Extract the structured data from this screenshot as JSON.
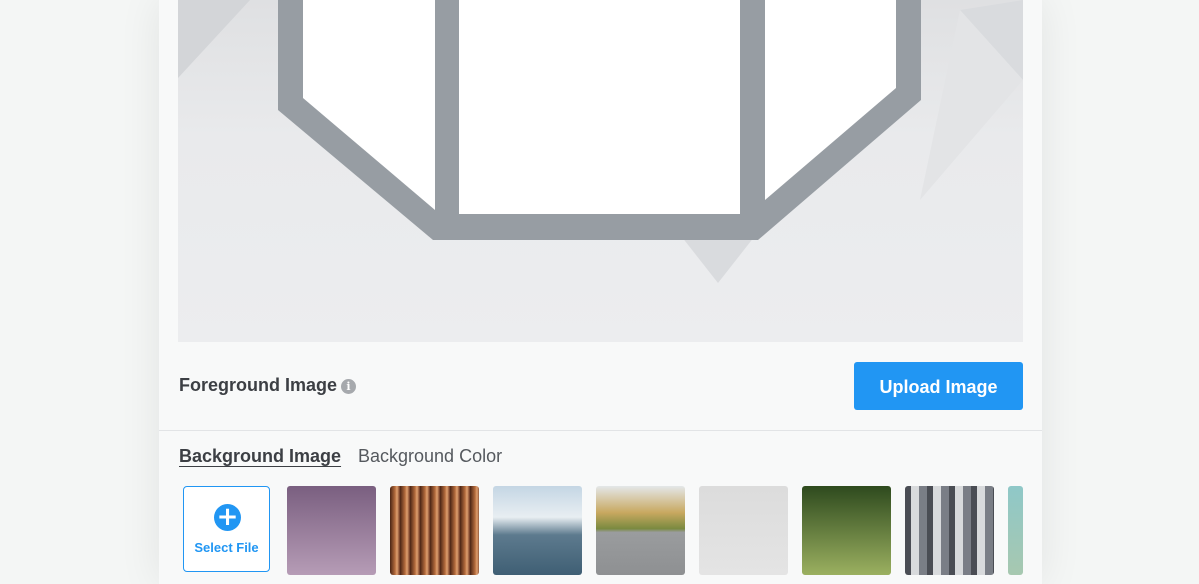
{
  "foreground": {
    "label": "Foreground Image",
    "info_icon": "info-icon",
    "upload_label": "Upload Image"
  },
  "background": {
    "tabs": [
      {
        "label": "Background Image",
        "active": true
      },
      {
        "label": "Background Color",
        "active": false
      }
    ],
    "select_file_label": "Select File",
    "select_file_icon": "plus-circle-icon",
    "thumbnails": [
      {
        "name": "thumb-purple-gradient",
        "colors": [
          "#7a5f80",
          "#b69cb6"
        ]
      },
      {
        "name": "thumb-wood-stripes",
        "colors": [
          "#5a2e1a",
          "#c07a48"
        ]
      },
      {
        "name": "thumb-sky-cityscape",
        "colors": [
          "#c9d8e4",
          "#4b6b80"
        ]
      },
      {
        "name": "thumb-tree-wall",
        "colors": [
          "#d9dde0",
          "#8a8d7a"
        ]
      },
      {
        "name": "thumb-light-gray",
        "colors": [
          "#dcdcdc",
          "#e4e4e4"
        ]
      },
      {
        "name": "thumb-green-trees",
        "colors": [
          "#2e4a1e",
          "#9bb060"
        ]
      },
      {
        "name": "thumb-row-houses",
        "colors": [
          "#6a6d74",
          "#c7c9cc"
        ]
      },
      {
        "name": "thumb-bokeh",
        "colors": [
          "#8fc8c8",
          "#a7c8b0"
        ]
      }
    ]
  },
  "colors": {
    "accent": "#2196f3",
    "frame": "#979da3"
  }
}
